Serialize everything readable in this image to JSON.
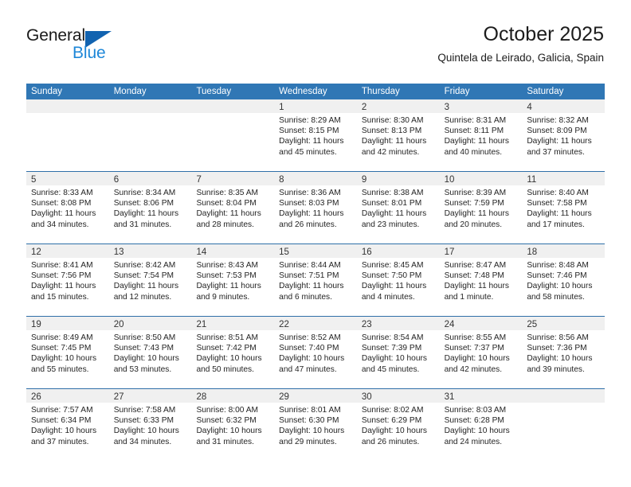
{
  "logo": {
    "word_top": "General",
    "word_bottom": "Blue",
    "triangle_color": "#1263b0",
    "blue_color": "#1e87d8"
  },
  "header": {
    "title": "October 2025",
    "subtitle": "Quintela de Leirado, Galicia, Spain"
  },
  "theme": {
    "header_row_bg": "#3077b5",
    "week_divider": "#2f6fa8",
    "day_band_bg": "#f0f0f0"
  },
  "weekdays": [
    "Sunday",
    "Monday",
    "Tuesday",
    "Wednesday",
    "Thursday",
    "Friday",
    "Saturday"
  ],
  "weeks": [
    [
      {
        "day": "",
        "empty": true,
        "lines": []
      },
      {
        "day": "",
        "empty": true,
        "lines": []
      },
      {
        "day": "",
        "empty": true,
        "lines": []
      },
      {
        "day": "1",
        "empty": false,
        "lines": [
          "Sunrise: 8:29 AM",
          "Sunset: 8:15 PM",
          "Daylight: 11 hours",
          "and 45 minutes."
        ]
      },
      {
        "day": "2",
        "empty": false,
        "lines": [
          "Sunrise: 8:30 AM",
          "Sunset: 8:13 PM",
          "Daylight: 11 hours",
          "and 42 minutes."
        ]
      },
      {
        "day": "3",
        "empty": false,
        "lines": [
          "Sunrise: 8:31 AM",
          "Sunset: 8:11 PM",
          "Daylight: 11 hours",
          "and 40 minutes."
        ]
      },
      {
        "day": "4",
        "empty": false,
        "lines": [
          "Sunrise: 8:32 AM",
          "Sunset: 8:09 PM",
          "Daylight: 11 hours",
          "and 37 minutes."
        ]
      }
    ],
    [
      {
        "day": "5",
        "empty": false,
        "lines": [
          "Sunrise: 8:33 AM",
          "Sunset: 8:08 PM",
          "Daylight: 11 hours",
          "and 34 minutes."
        ]
      },
      {
        "day": "6",
        "empty": false,
        "lines": [
          "Sunrise: 8:34 AM",
          "Sunset: 8:06 PM",
          "Daylight: 11 hours",
          "and 31 minutes."
        ]
      },
      {
        "day": "7",
        "empty": false,
        "lines": [
          "Sunrise: 8:35 AM",
          "Sunset: 8:04 PM",
          "Daylight: 11 hours",
          "and 28 minutes."
        ]
      },
      {
        "day": "8",
        "empty": false,
        "lines": [
          "Sunrise: 8:36 AM",
          "Sunset: 8:03 PM",
          "Daylight: 11 hours",
          "and 26 minutes."
        ]
      },
      {
        "day": "9",
        "empty": false,
        "lines": [
          "Sunrise: 8:38 AM",
          "Sunset: 8:01 PM",
          "Daylight: 11 hours",
          "and 23 minutes."
        ]
      },
      {
        "day": "10",
        "empty": false,
        "lines": [
          "Sunrise: 8:39 AM",
          "Sunset: 7:59 PM",
          "Daylight: 11 hours",
          "and 20 minutes."
        ]
      },
      {
        "day": "11",
        "empty": false,
        "lines": [
          "Sunrise: 8:40 AM",
          "Sunset: 7:58 PM",
          "Daylight: 11 hours",
          "and 17 minutes."
        ]
      }
    ],
    [
      {
        "day": "12",
        "empty": false,
        "lines": [
          "Sunrise: 8:41 AM",
          "Sunset: 7:56 PM",
          "Daylight: 11 hours",
          "and 15 minutes."
        ]
      },
      {
        "day": "13",
        "empty": false,
        "lines": [
          "Sunrise: 8:42 AM",
          "Sunset: 7:54 PM",
          "Daylight: 11 hours",
          "and 12 minutes."
        ]
      },
      {
        "day": "14",
        "empty": false,
        "lines": [
          "Sunrise: 8:43 AM",
          "Sunset: 7:53 PM",
          "Daylight: 11 hours",
          "and 9 minutes."
        ]
      },
      {
        "day": "15",
        "empty": false,
        "lines": [
          "Sunrise: 8:44 AM",
          "Sunset: 7:51 PM",
          "Daylight: 11 hours",
          "and 6 minutes."
        ]
      },
      {
        "day": "16",
        "empty": false,
        "lines": [
          "Sunrise: 8:45 AM",
          "Sunset: 7:50 PM",
          "Daylight: 11 hours",
          "and 4 minutes."
        ]
      },
      {
        "day": "17",
        "empty": false,
        "lines": [
          "Sunrise: 8:47 AM",
          "Sunset: 7:48 PM",
          "Daylight: 11 hours",
          "and 1 minute."
        ]
      },
      {
        "day": "18",
        "empty": false,
        "lines": [
          "Sunrise: 8:48 AM",
          "Sunset: 7:46 PM",
          "Daylight: 10 hours",
          "and 58 minutes."
        ]
      }
    ],
    [
      {
        "day": "19",
        "empty": false,
        "lines": [
          "Sunrise: 8:49 AM",
          "Sunset: 7:45 PM",
          "Daylight: 10 hours",
          "and 55 minutes."
        ]
      },
      {
        "day": "20",
        "empty": false,
        "lines": [
          "Sunrise: 8:50 AM",
          "Sunset: 7:43 PM",
          "Daylight: 10 hours",
          "and 53 minutes."
        ]
      },
      {
        "day": "21",
        "empty": false,
        "lines": [
          "Sunrise: 8:51 AM",
          "Sunset: 7:42 PM",
          "Daylight: 10 hours",
          "and 50 minutes."
        ]
      },
      {
        "day": "22",
        "empty": false,
        "lines": [
          "Sunrise: 8:52 AM",
          "Sunset: 7:40 PM",
          "Daylight: 10 hours",
          "and 47 minutes."
        ]
      },
      {
        "day": "23",
        "empty": false,
        "lines": [
          "Sunrise: 8:54 AM",
          "Sunset: 7:39 PM",
          "Daylight: 10 hours",
          "and 45 minutes."
        ]
      },
      {
        "day": "24",
        "empty": false,
        "lines": [
          "Sunrise: 8:55 AM",
          "Sunset: 7:37 PM",
          "Daylight: 10 hours",
          "and 42 minutes."
        ]
      },
      {
        "day": "25",
        "empty": false,
        "lines": [
          "Sunrise: 8:56 AM",
          "Sunset: 7:36 PM",
          "Daylight: 10 hours",
          "and 39 minutes."
        ]
      }
    ],
    [
      {
        "day": "26",
        "empty": false,
        "lines": [
          "Sunrise: 7:57 AM",
          "Sunset: 6:34 PM",
          "Daylight: 10 hours",
          "and 37 minutes."
        ]
      },
      {
        "day": "27",
        "empty": false,
        "lines": [
          "Sunrise: 7:58 AM",
          "Sunset: 6:33 PM",
          "Daylight: 10 hours",
          "and 34 minutes."
        ]
      },
      {
        "day": "28",
        "empty": false,
        "lines": [
          "Sunrise: 8:00 AM",
          "Sunset: 6:32 PM",
          "Daylight: 10 hours",
          "and 31 minutes."
        ]
      },
      {
        "day": "29",
        "empty": false,
        "lines": [
          "Sunrise: 8:01 AM",
          "Sunset: 6:30 PM",
          "Daylight: 10 hours",
          "and 29 minutes."
        ]
      },
      {
        "day": "30",
        "empty": false,
        "lines": [
          "Sunrise: 8:02 AM",
          "Sunset: 6:29 PM",
          "Daylight: 10 hours",
          "and 26 minutes."
        ]
      },
      {
        "day": "31",
        "empty": false,
        "lines": [
          "Sunrise: 8:03 AM",
          "Sunset: 6:28 PM",
          "Daylight: 10 hours",
          "and 24 minutes."
        ]
      },
      {
        "day": "",
        "empty": true,
        "lines": []
      }
    ]
  ]
}
